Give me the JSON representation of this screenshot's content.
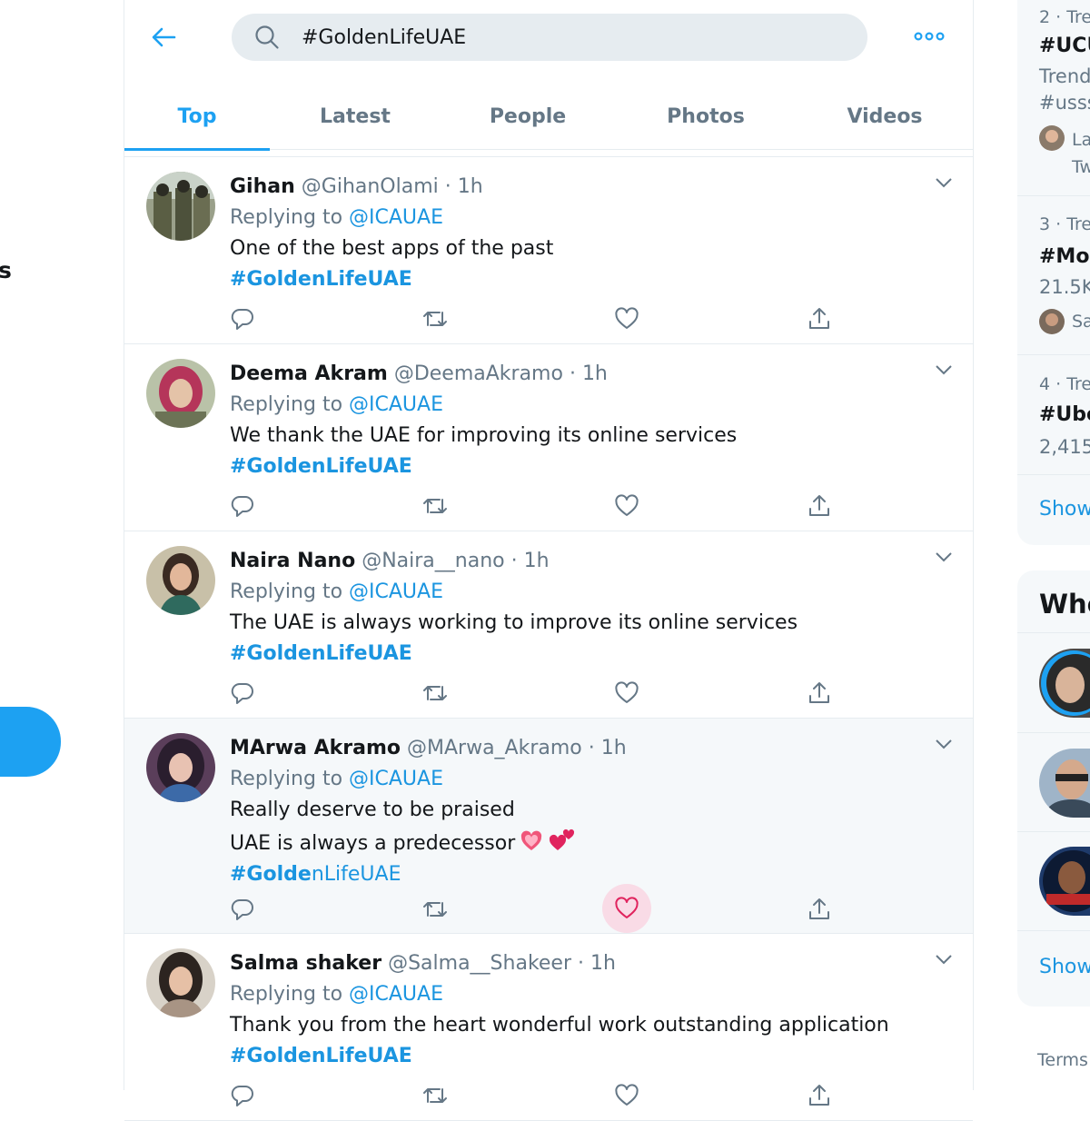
{
  "search": {
    "query": "#GoldenLifeUAE"
  },
  "tabs": [
    "Top",
    "Latest",
    "People",
    "Photos",
    "Videos"
  ],
  "left": {
    "nav_fragment": "s"
  },
  "tweets": [
    {
      "name": "Gihan",
      "handle": "@GihanOlami",
      "time": "1h",
      "reply_prefix": "Replying to",
      "reply_to": "@ICAUAE",
      "lines": [
        "One of the best apps of the past"
      ],
      "hashtag": "#GoldenLifeUAE",
      "liked": false
    },
    {
      "name": "Deema Akram",
      "handle": "@DeemaAkramo",
      "time": "1h",
      "reply_prefix": "Replying to",
      "reply_to": "@ICAUAE",
      "lines": [
        "We thank the UAE for improving its online services"
      ],
      "hashtag": "#GoldenLifeUAE",
      "liked": false
    },
    {
      "name": "Naira Nano",
      "handle": "@Naira__nano",
      "time": "1h",
      "reply_prefix": "Replying to",
      "reply_to": "@ICAUAE",
      "lines": [
        "The UAE is always working to improve its online services"
      ],
      "hashtag": "#GoldenLifeUAE",
      "liked": false
    },
    {
      "name": "MArwa Akramo",
      "handle": "@MArwa_Akramo",
      "time": "1h",
      "reply_prefix": "Replying to",
      "reply_to": "@ICAUAE",
      "lines": [
        "Really deserve to be praised",
        "UAE is always a predecessor"
      ],
      "emoji": [
        "sparkling-heart-icon",
        "two-hearts-icon"
      ],
      "hashtag_bold": "#Golde",
      "hashtag_rest": "nLifeUAE",
      "liked": true
    },
    {
      "name": "Salma shaker",
      "handle": "@Salma__Shakeer",
      "time": "1h",
      "reply_prefix": "Replying to",
      "reply_to": "@ICAUAE",
      "lines": [
        "Thank you from the heart wonderful work outstanding application"
      ],
      "hashtag": "#GoldenLifeUAE",
      "liked": false
    }
  ],
  "trends": [
    {
      "rank": "2 · Tre",
      "name": "#UCU",
      "sub1": "Trend",
      "sub2": "#usss",
      "mini_line1": "La",
      "mini_line2": "Tw"
    },
    {
      "rank": "3 · Tre",
      "name": "#Mor",
      "count": "21.5K",
      "mini_line1": "Sa"
    },
    {
      "rank": "4 · Tre",
      "name": "#Ube",
      "count": "2,415"
    }
  ],
  "trends_show_more": "Show",
  "who_to_follow": {
    "title": "Whe",
    "show_more": "Show"
  },
  "footer": {
    "terms": "Terms"
  },
  "colors": {
    "accent": "#1da1f2",
    "link": "#1b95e0",
    "like": "#e0245e",
    "muted": "#657786"
  }
}
